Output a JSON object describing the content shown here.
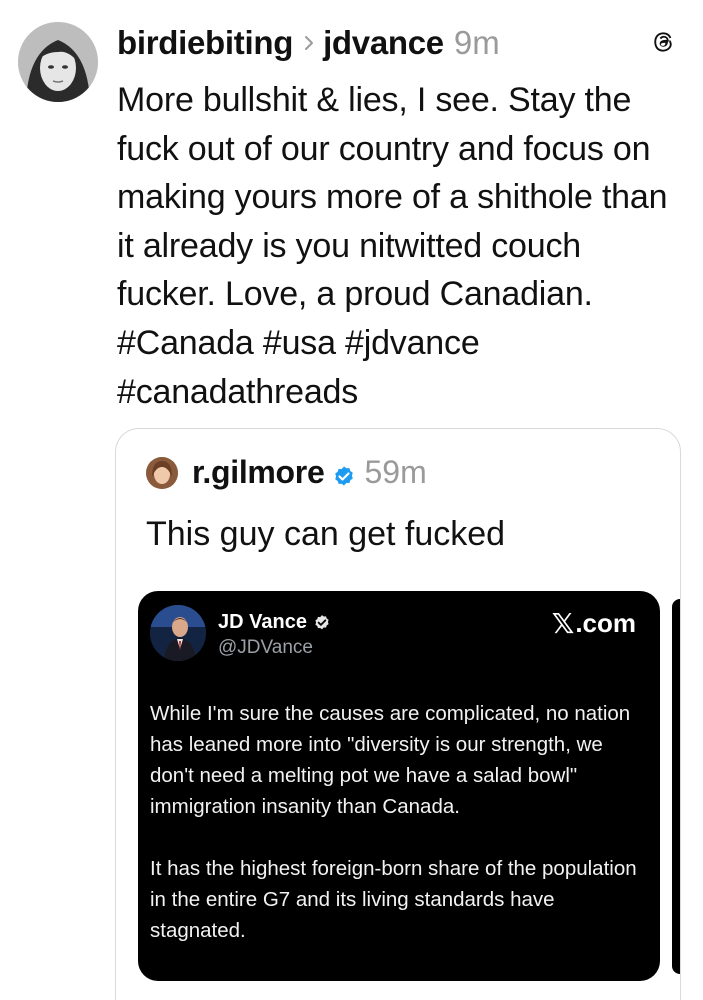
{
  "post": {
    "username": "birdiebiting",
    "reply_to": "jdvance",
    "timestamp": "9m",
    "body": "More bullshit & lies, I see. Stay the fuck out of our country and focus on making yours more of a shithole than it already is you nitwitted couch fucker. Love, a proud Canadian. #Canada #usa #jdvance #canadathreads",
    "avatar_icon": "profile-photo",
    "threads_icon": "threads-logo-icon"
  },
  "quoted_post": {
    "username": "r.gilmore",
    "verified": true,
    "timestamp": "59m",
    "text": "This guy can get fucked",
    "embedded_x_post": {
      "display_name": "JD Vance",
      "verified": true,
      "handle": "@JDVance",
      "site_logo": "𝕏",
      "site": ".com",
      "paragraph_1": "While I'm sure the causes are complicated, no nation has leaned more into \"diversity is our strength, we don't need a melting pot we have a salad bowl\" immigration insanity than Canada.",
      "paragraph_2": "It has the highest foreign-born share of the population in the entire G7 and its living standards have stagnated."
    }
  },
  "colors": {
    "text": "#111111",
    "muted": "#9a9a9a",
    "card_border": "#d9d9d9",
    "verified_blue": "#1d9bf0",
    "x_background": "#000000"
  }
}
